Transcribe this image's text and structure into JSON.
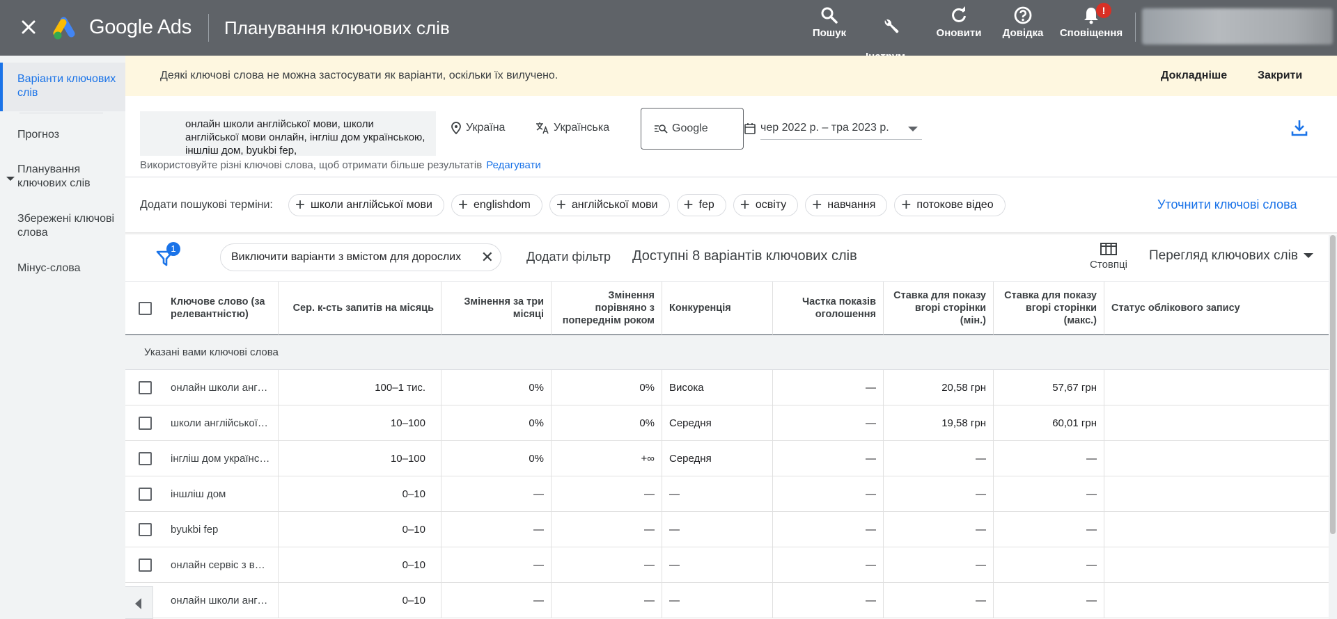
{
  "app": {
    "product_name": "Google Ads",
    "page_title": "Планування ключових слів"
  },
  "topbar": {
    "actions": [
      {
        "label": "Пошук",
        "icon": "search-icon"
      },
      {
        "label": "Інструм…\nй нала…",
        "icon": "wrench-icon"
      },
      {
        "label": "Оновити",
        "icon": "refresh-icon"
      },
      {
        "label": "Довідка",
        "icon": "help-icon"
      },
      {
        "label": "Сповіщення",
        "icon": "bell-icon",
        "badge": "!"
      }
    ]
  },
  "sidebar": {
    "items": [
      {
        "label": "Варіанти ключових слів",
        "active": true
      },
      {
        "label": "Прогноз"
      },
      {
        "label": "Планування ключових слів",
        "expandable": true
      },
      {
        "label": "Збережені ключові слова"
      },
      {
        "label": "Мінус-слова"
      }
    ]
  },
  "banner": {
    "message": "Деякі ключові слова не можна застосувати як варіанти, оскільки їх вилучено.",
    "learn_more": "Докладніше",
    "close": "Закрити"
  },
  "query": {
    "seed_keywords": "онлайн школи англійської мови, школи англійської мови онлайн, інгліш дом українською, іншліш дом, byukbi fep,",
    "location": "Україна",
    "language": "Українська",
    "network": "Google",
    "date_range": "чер 2022 р. – тра 2023 р.",
    "hint": "Використовуйте різні ключові слова, щоб отримати більше результатів",
    "edit_link": "Редагувати"
  },
  "add_terms": {
    "label": "Додати пошукові терміни:",
    "chips": [
      "школи англійської мови",
      "englishdom",
      "англійської мови",
      "fep",
      "освіту",
      "навчання",
      "потокове відео"
    ],
    "refine_link": "Уточнити ключові слова"
  },
  "filter_bar": {
    "filter_count": "1",
    "active_filter": "Виключити варіанти з вмістом для дорослих",
    "add_filter": "Додати фільтр",
    "available_text": "Доступні 8 варіантів ключових слів",
    "columns_label": "Стовпці",
    "view_label": "Перегляд ключових слів"
  },
  "table": {
    "headers": {
      "keyword": "Ключове слово (за релевантністю)",
      "avg_searches": "Сер. к-сть запитів на місяць",
      "three_month": "Змінення за три місяці",
      "yoy": "Змінення порівняно з попереднім роком",
      "competition": "Конкуренція",
      "impr_share": "Частка показів оголошення",
      "bid_low": "Ставка для показу вгорі сторінки (мін.)",
      "bid_high": "Ставка для показу вгорі сторінки (макс.)",
      "status": "Статус облікового запису"
    },
    "group_label": "Указані вами ключові слова",
    "rows": [
      {
        "keyword": "онлайн школи англійської мови",
        "avg": "100–1 тис.",
        "three": "0%",
        "yoy": "0%",
        "comp": "Висока",
        "share": "—",
        "low": "20,58 грн",
        "high": "57,67 грн"
      },
      {
        "keyword": "школи англійської мови онлайн",
        "avg": "10–100",
        "three": "0%",
        "yoy": "0%",
        "comp": "Середня",
        "share": "—",
        "low": "19,58 грн",
        "high": "60,01 грн"
      },
      {
        "keyword": "інгліш дом українською",
        "avg": "10–100",
        "three": "0%",
        "yoy": "+∞",
        "comp": "Середня",
        "share": "—",
        "low": "—",
        "high": "—"
      },
      {
        "keyword": "іншліш дом",
        "avg": "0–10",
        "three": "—",
        "yoy": "—",
        "comp": "—",
        "share": "—",
        "low": "—",
        "high": "—"
      },
      {
        "keyword": "byukbi fep",
        "avg": "0–10",
        "three": "—",
        "yoy": "—",
        "comp": "—",
        "share": "—",
        "low": "—",
        "high": "—"
      },
      {
        "keyword": "онлайн сервіс з вивчення англійської",
        "avg": "0–10",
        "three": "—",
        "yoy": "—",
        "comp": "—",
        "share": "—",
        "low": "—",
        "high": "—"
      },
      {
        "keyword": "онлайн школи англійської мови для дітей",
        "avg": "0–10",
        "three": "—",
        "yoy": "—",
        "comp": "—",
        "share": "—",
        "low": "—",
        "high": "—"
      }
    ]
  },
  "colors": {
    "topbar": "#5f6368",
    "accent": "#1a73e8",
    "banner": "#fef7e0",
    "badge": "#d93025"
  }
}
